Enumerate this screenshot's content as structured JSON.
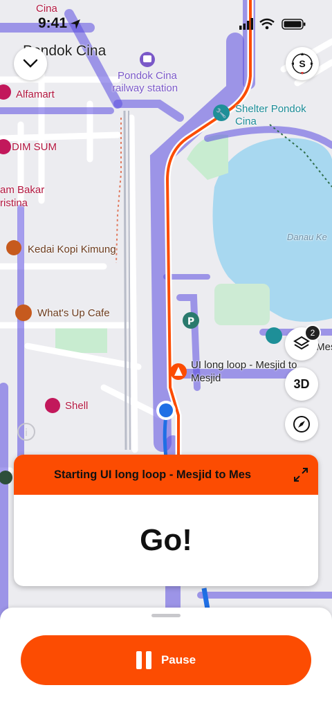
{
  "status_bar": {
    "time": "9:41"
  },
  "map": {
    "labels": {
      "cina_top": "Cina",
      "area_title": "Pondok Cina",
      "station": "Pondok Cina",
      "station_line2": "railway station",
      "alfamart": "Alfamart",
      "dim_sum": "DIM SUM",
      "bakar_1": "am Bakar",
      "bakar_2": "ristina",
      "kedai_kopi": "Kedai Kopi Kimung",
      "whats_up": "What's Up Cafe",
      "shell": "Shell",
      "shelter_1": "Shelter Pondok",
      "shelter_2": "Cina",
      "danau": "Danau Ke",
      "route_1": "UI long loop - Mesjid to",
      "route_2": "Mesjid",
      "partial_mes": "r Mes"
    },
    "colors": {
      "route_orange": "#fc4c02",
      "heat_purple": "#5b4de0",
      "lake": "#a8d8f0",
      "park": "#c8ecd0",
      "user_dot": "#1f6fe5"
    }
  },
  "controls": {
    "collapse_icon": "chevron-down-icon",
    "compass_letter": "S",
    "layers_badge": "2",
    "button_3d": "3D",
    "recenter_icon": "navigation-compass-icon"
  },
  "instruction": {
    "title": "Starting UI long loop - Mesjid to Mes",
    "text": "Go!"
  },
  "bottom": {
    "pause_label": "Pause"
  }
}
